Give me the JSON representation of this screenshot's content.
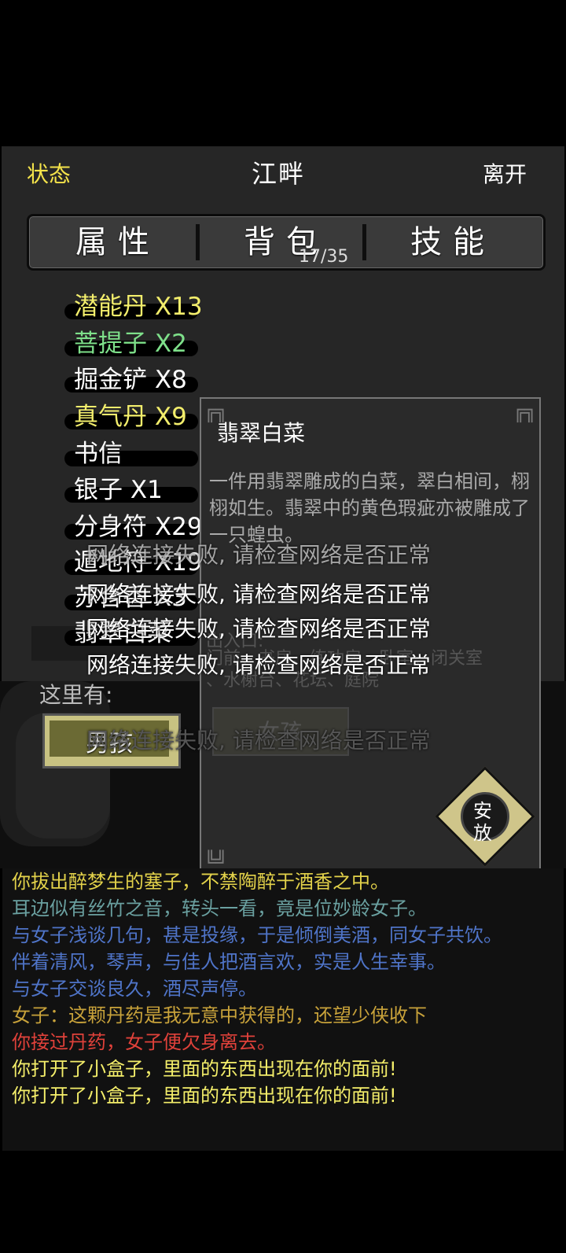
{
  "header": {
    "status_label": "状态",
    "location": "江畔",
    "leave_label": "离开"
  },
  "tabs": [
    {
      "label": "属性"
    },
    {
      "label": "背包"
    },
    {
      "label": "技能"
    }
  ],
  "bag_count": "17/35",
  "bag_items": [
    {
      "label": "潜能丹 X13",
      "color": "#f3ee6c"
    },
    {
      "label": "菩提子 X2",
      "color": "#7ee08a"
    },
    {
      "label": "掘金铲 X8",
      "color": "#ffffff"
    },
    {
      "label": "真气丹 X9",
      "color": "#f3ee6c"
    },
    {
      "label": "书信",
      "color": "#ffffff"
    },
    {
      "label": "银子 X1",
      "color": "#ffffff"
    },
    {
      "label": "分身符 X29",
      "color": "#ffffff"
    },
    {
      "label": "遁地符 X19",
      "color": "#ffffff"
    },
    {
      "label": "苏合香 X3",
      "color": "#ffffff"
    },
    {
      "label": "翡翠白菜",
      "color": "#ffffff"
    }
  ],
  "scene": {
    "here_label": "这里有:",
    "npc_button": "男孩",
    "npc_button_2": "女孩",
    "locations": "门前、书房、练功房、卧室、闭关室",
    "locations_line2": "、水榭台、花坛、庭院",
    "faded_line": "出入口:"
  },
  "item_popup": {
    "title": "翡翠白菜",
    "description": "一件用翡翠雕成的白菜，翠白相间，栩栩如生。翡翠中的黄色瑕疵亦被雕成了一只蝗虫。",
    "action_label_1": "安",
    "action_label_2": "放"
  },
  "toasts": [
    "网络连接失败, 请检查网络是否正常",
    "网络连接失败, 请检查网络是否正常",
    "网络连接失败, 请检查网络是否正常",
    "网络连接失败, 请检查网络是否正常",
    "网络连接失败, 请检查网络是否正常"
  ],
  "log": [
    {
      "text": "你拔出醉梦生的塞子，不禁陶醉于酒香之中。",
      "color": "#e3d24a"
    },
    {
      "text": "耳边似有丝竹之音，转头一看，竟是位妙龄女子。",
      "color": "#6aa0a0"
    },
    {
      "text": "与女子浅谈几句，甚是投缘，于是倾倒美酒，同女子共饮。",
      "color": "#4f74c8"
    },
    {
      "text": "伴着清风，琴声，与佳人把酒言欢，实是人生幸事。",
      "color": "#4f74c8"
    },
    {
      "text": "与女子交谈良久，酒尽声停。",
      "color": "#4f74c8"
    },
    {
      "text": "女子：这颗丹药是我无意中获得的，还望少侠收下",
      "color": "#c8a23a"
    },
    {
      "text": "你接过丹药，女子便欠身离去。",
      "color": "#e0413a"
    },
    {
      "text": "你打开了小盒子，里面的东西出现在你的面前!",
      "color": "#f4ee6a"
    },
    {
      "text": "你打开了小盒子，里面的东西出现在你的面前!",
      "color": "#f4ee6a"
    }
  ]
}
